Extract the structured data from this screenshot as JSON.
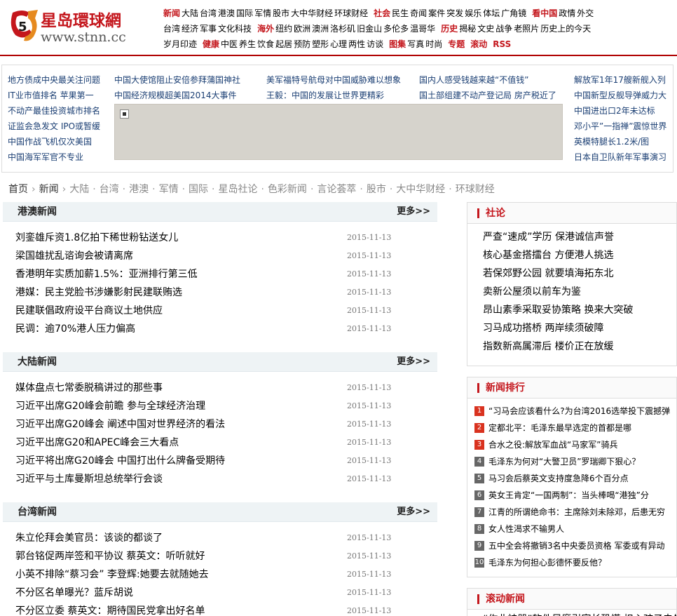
{
  "header": {
    "logo_title": "星岛環球網",
    "logo_url": "www.stnn.cc",
    "nav_rows": [
      [
        {
          "t": "新闻",
          "hl": true
        },
        {
          "t": "大陆"
        },
        {
          "t": "台湾"
        },
        {
          "t": "港澳"
        },
        {
          "t": "国际"
        },
        {
          "t": "军情"
        },
        {
          "t": "股市"
        },
        {
          "t": "大中华财经"
        },
        {
          "t": "环球财经"
        },
        {
          "t": "社会",
          "hl": true
        },
        {
          "t": "民生"
        },
        {
          "t": "奇闻"
        },
        {
          "t": "案件"
        },
        {
          "t": "突发"
        },
        {
          "t": "娱乐"
        },
        {
          "t": "体坛"
        },
        {
          "t": "广角镜"
        },
        {
          "t": "看中国",
          "hl": true
        },
        {
          "t": "政情"
        },
        {
          "t": "外交"
        }
      ],
      [
        {
          "t": "台湾"
        },
        {
          "t": "经济"
        },
        {
          "t": "军事"
        },
        {
          "t": "文化科技"
        },
        {
          "t": "海外",
          "hl": true
        },
        {
          "t": "纽约"
        },
        {
          "t": "欧洲"
        },
        {
          "t": "澳洲"
        },
        {
          "t": "洛杉矶"
        },
        {
          "t": "旧金山"
        },
        {
          "t": "多伦多"
        },
        {
          "t": "温哥华"
        },
        {
          "t": "历史",
          "hl": true
        },
        {
          "t": "揭秘"
        },
        {
          "t": "文史"
        },
        {
          "t": "战争"
        },
        {
          "t": "老照片"
        },
        {
          "t": "历史上的今天"
        }
      ],
      [
        {
          "t": "岁月印迹"
        },
        {
          "t": "健康",
          "hl": true
        },
        {
          "t": "中医"
        },
        {
          "t": "养生"
        },
        {
          "t": "饮食"
        },
        {
          "t": "起居"
        },
        {
          "t": "预防"
        },
        {
          "t": "塑形"
        },
        {
          "t": "心理"
        },
        {
          "t": "两性"
        },
        {
          "t": "访谈"
        },
        {
          "t": "图集",
          "hl": true
        },
        {
          "t": "写真"
        },
        {
          "t": "时尚"
        },
        {
          "t": "专题",
          "hl": true
        },
        {
          "t": "滚动",
          "hl": true
        },
        {
          "t": "RSS",
          "hl": true
        }
      ]
    ]
  },
  "focus": {
    "left": [
      "地方债成中央最关注问题",
      "IT业市值排名 苹果第一",
      "不动产最佳投资城市排名",
      "证监会急发文 IPO或暂缓",
      "中国作战飞机仅次美国",
      "中国海军军官不专业"
    ],
    "grid_row1": [
      "中国大使馆阻止安倍参拜蒲国神社",
      "美军福特号航母对中国威胁难以想象",
      "国内人感受钱越来越“不值钱”"
    ],
    "grid_row2": [
      "中国经济规模超美国2014大事件",
      "王毅：中国的发展让世界更精彩",
      "国土部组建不动产登记局 房产税近了"
    ],
    "right": [
      "解放军1年17艘新舰入列",
      "中国新型反舰导弹威力大",
      "中国进出口2年未达标",
      "邓小平”一指禅”震惊世界",
      "英模特腿长1.2米/图",
      "日本自卫队新年军事演习"
    ]
  },
  "breadcrumb": [
    "首页",
    "新闻",
    "大陆",
    "台湾",
    "港澳",
    "军情",
    "国际",
    "星岛社论",
    "色彩新闻",
    "言论荟萃",
    "股市",
    "大中华财经",
    "环球财经"
  ],
  "sections": [
    {
      "title": "港澳新闻",
      "more": "更多>>",
      "items": [
        {
          "t": "刘銮雄斥资1.8亿拍下稀世粉钻送女儿",
          "d": "2015-11-13"
        },
        {
          "t": "梁国雄扰乱谘询会被请离席",
          "d": "2015-11-13"
        },
        {
          "t": "香港明年实质加薪1.5%：亚洲排行第三低",
          "d": "2015-11-13"
        },
        {
          "t": "港媒：民主党脸书涉嫌影射民建联贿选",
          "d": "2015-11-13"
        },
        {
          "t": "民建联倡政府设平台商议土地供应",
          "d": "2015-11-13"
        },
        {
          "t": "民调：逾70%港人压力偏高",
          "d": "2015-11-13"
        }
      ]
    },
    {
      "title": "大陆新闻",
      "more": "更多>>",
      "items": [
        {
          "t": "媒体盘点七常委脱稿讲过的那些事",
          "d": "2015-11-13"
        },
        {
          "t": "习近平出席G20峰会前瞻 参与全球经济治理",
          "d": "2015-11-13"
        },
        {
          "t": "习近平出席G20峰会 阐述中国对世界经济的看法",
          "d": "2015-11-13"
        },
        {
          "t": "习近平出席G20和APEC峰会三大看点",
          "d": "2015-11-13"
        },
        {
          "t": "习近平将出席G20峰会 中国打出什么牌备受期待",
          "d": "2015-11-13"
        },
        {
          "t": "习近平与土库曼斯坦总统举行会谈",
          "d": "2015-11-13"
        }
      ]
    },
    {
      "title": "台湾新闻",
      "more": "更多>>",
      "items": [
        {
          "t": "朱立伦拜会美官员：该谈的都谈了",
          "d": "2015-11-13"
        },
        {
          "t": "郭台铭促两岸签和平协议 蔡英文：听听就好",
          "d": "2015-11-13"
        },
        {
          "t": "小英不排除“蔡习会” 李登辉:她要去就随她去",
          "d": "2015-11-13"
        },
        {
          "t": "不分区名单曝光？蓝斥胡说",
          "d": "2015-11-13"
        },
        {
          "t": "不分区立委 蔡英文：期待国民党拿出好名单",
          "d": "2015-11-13"
        }
      ]
    }
  ],
  "editorial": {
    "title": "社论",
    "items": [
      "严查“速成”学历 保港诚信声誉",
      "核心基金搭擂台 方便港人挑选",
      "若保郊野公园 就要填海拓东北",
      "卖新公屋须以前车为鉴",
      "昂山素季采取妥协策略 换来大突破",
      "习马成功搭桥 两岸续须破障",
      "指数新高属滞后 楼价正在放缓"
    ]
  },
  "ranking": {
    "title": "新闻排行",
    "items": [
      "“习马会应该看什么?为台湾2016选举投下震撼弹",
      "定都北平：毛泽东最早选定的首都是哪",
      "合水之役:解放军血战“马家军”骑兵",
      "毛泽东为何对“大警卫员”罗瑞卿下狠心？",
      "马习会后蔡英文支持度急降6个百分点",
      "英女王肯定“一国两制”：当头棒喝“港独”分",
      "江青的所谓绝命书：主席除刘未除邓，后患无穷",
      "女人性渴求不输男人",
      "五中全会将撤销3名中央委员资格 军委或有异动",
      "毛泽东为何担心彭德怀要反他？"
    ]
  },
  "rolling": {
    "title": "滚动新闻",
    "first_item": "“作业神器”软件风靡引家长恐慌 担心孩子未先用者才"
  },
  "colors": {
    "brand_red": "#c4161c",
    "link_blue": "#1a3e73",
    "section_bg": "#eef3f5"
  }
}
